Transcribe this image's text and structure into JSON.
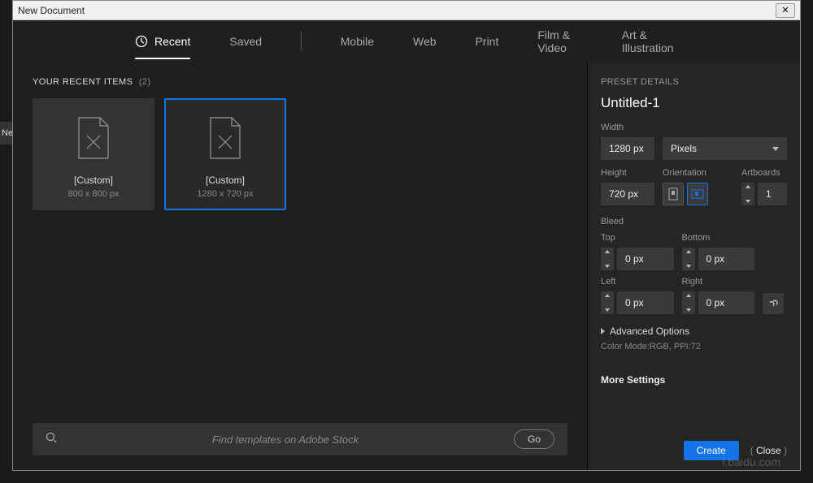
{
  "window": {
    "title": "New Document",
    "close_glyph": "✕"
  },
  "tabs": {
    "recent": "Recent",
    "saved": "Saved",
    "mobile": "Mobile",
    "web": "Web",
    "print": "Print",
    "film": "Film & Video",
    "art": "Art & Illustration"
  },
  "gallery": {
    "header": "YOUR RECENT ITEMS",
    "count": "(2)",
    "items": [
      {
        "label": "[Custom]",
        "sub": "800 x 800 px",
        "selected": false
      },
      {
        "label": "[Custom]",
        "sub": "1280 x 720 px",
        "selected": true
      }
    ],
    "search_placeholder": "Find templates on Adobe Stock",
    "go_label": "Go"
  },
  "panel": {
    "head": "PRESET DETAILS",
    "doc_name": "Untitled-1",
    "width_label": "Width",
    "width_value": "1280 px",
    "units_label": "Pixels",
    "height_label": "Height",
    "height_value": "720 px",
    "orientation_label": "Orientation",
    "artboards_label": "Artboards",
    "artboards_value": "1",
    "bleed_label": "Bleed",
    "top_label": "Top",
    "bottom_label": "Bottom",
    "left_label": "Left",
    "right_label": "Right",
    "bleed_top": "0 px",
    "bleed_bottom": "0 px",
    "bleed_left": "0 px",
    "bleed_right": "0 px",
    "advanced_label": "Advanced Options",
    "colormode": "Color Mode:RGB, PPI:72",
    "more_settings": "More Settings",
    "create": "Create",
    "close": "Close"
  },
  "bg": {
    "nev": "Nev"
  },
  "watermark": "i.baidu.com"
}
